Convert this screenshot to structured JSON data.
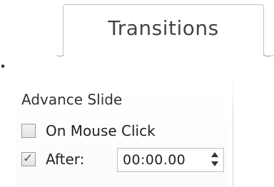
{
  "ribbon": {
    "active_tab": "Transitions"
  },
  "advance_slide": {
    "title": "Advance Slide",
    "on_mouse_click": {
      "label": "On Mouse Click",
      "checked": false
    },
    "after": {
      "label": "After:",
      "checked": true,
      "time_value": "00:00.00",
      "check_glyph": "✓"
    },
    "spinner_icon": "up-down-spinner-icon"
  },
  "colors": {
    "tab_border": "#c3c3c3",
    "text": "#222222",
    "checkbox_border": "#9a9a9a"
  }
}
